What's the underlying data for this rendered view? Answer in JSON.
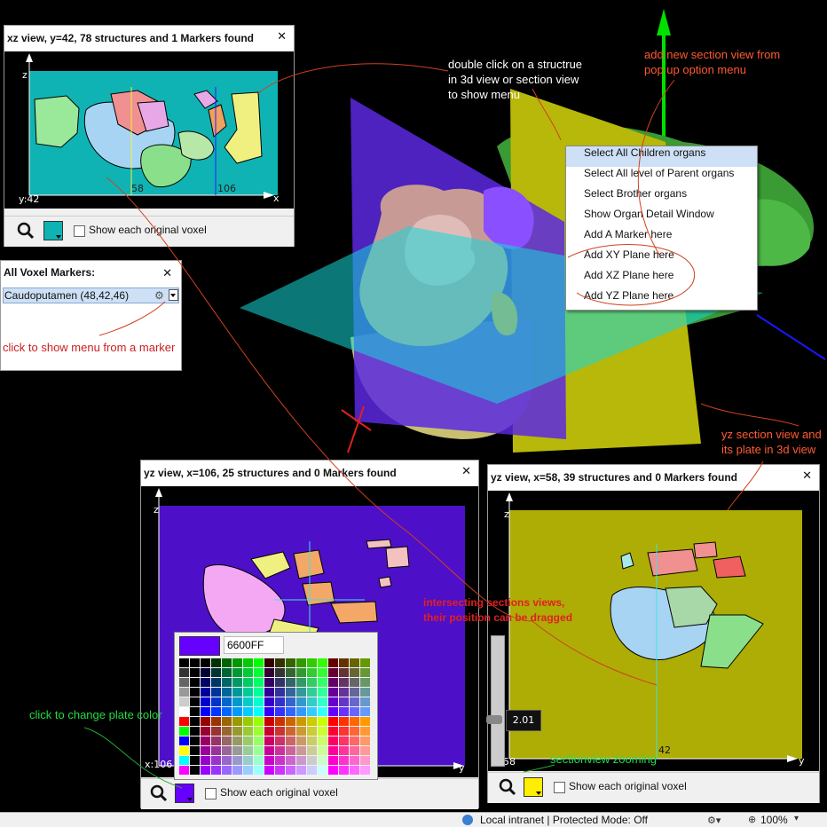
{
  "colors": {
    "xz_plate": "#0fb3b3",
    "yz106_plate": "#4d10c8",
    "yz58_plate": "#adad05",
    "annotation_dark": "#cc2020",
    "annotation_light": "#ff5a30",
    "annotation_green": "#22dd44",
    "menu_highlight": "#cde0f5"
  },
  "xz_window": {
    "title": "xz view, y=42, 78 structures and 1 Markers found",
    "axis_z": "z",
    "axis_x": "x",
    "coord": "y:42",
    "tick_a": "58",
    "tick_b": "106",
    "voxel_label": "Show each original voxel",
    "swatch_color": "#0fb3b3",
    "zoom_icon": "magnifier-icon"
  },
  "markers_window": {
    "title": "All Voxel Markers:",
    "marker": "Caudoputamen  (48,42,46)",
    "hint": "click to show menu from a marker"
  },
  "context_menu": {
    "items": [
      "Select All Children organs",
      "Select All level of Parent organs",
      "Select Brother organs",
      "Show Organ Detail Window",
      "Add A Marker here",
      "Add XY Plane here",
      "Add XZ Plane here",
      "Add YZ Plane here"
    ]
  },
  "annotations": {
    "double_click": [
      "double click on a structrue",
      "in 3d view or section view",
      "to show menu"
    ],
    "add_new": [
      "add new section view from",
      "pop up option menu"
    ],
    "yz_section": [
      "yz section view and",
      "its plate in 3d view"
    ],
    "intersecting": [
      "intersecting sections views,",
      "their position can be dragged"
    ],
    "plate_color": "click to change plate color",
    "zooming": "sectionview zooming"
  },
  "yz106_window": {
    "title": "yz view, x=106, 25 structures and 0 Markers found",
    "axis_z": "z",
    "axis_y": "y",
    "coord": "x:106",
    "voxel_label": "Show each original voxel",
    "swatch_color": "#6600ff"
  },
  "color_picker": {
    "hex": "6600FF",
    "preview_color": "#6600ff"
  },
  "yz58_window": {
    "title": "yz view, x=58, 39 structures and 0 Markers found",
    "axis_z": "z",
    "axis_y": "y",
    "coord": "58",
    "tick": "42",
    "zoom_value": "2.01",
    "voxel_label": "Show each original voxel",
    "swatch_color": "#ffee00"
  },
  "statusbar": {
    "zone": "Local intranet | Protected Mode: Off",
    "zoom": "100%"
  }
}
